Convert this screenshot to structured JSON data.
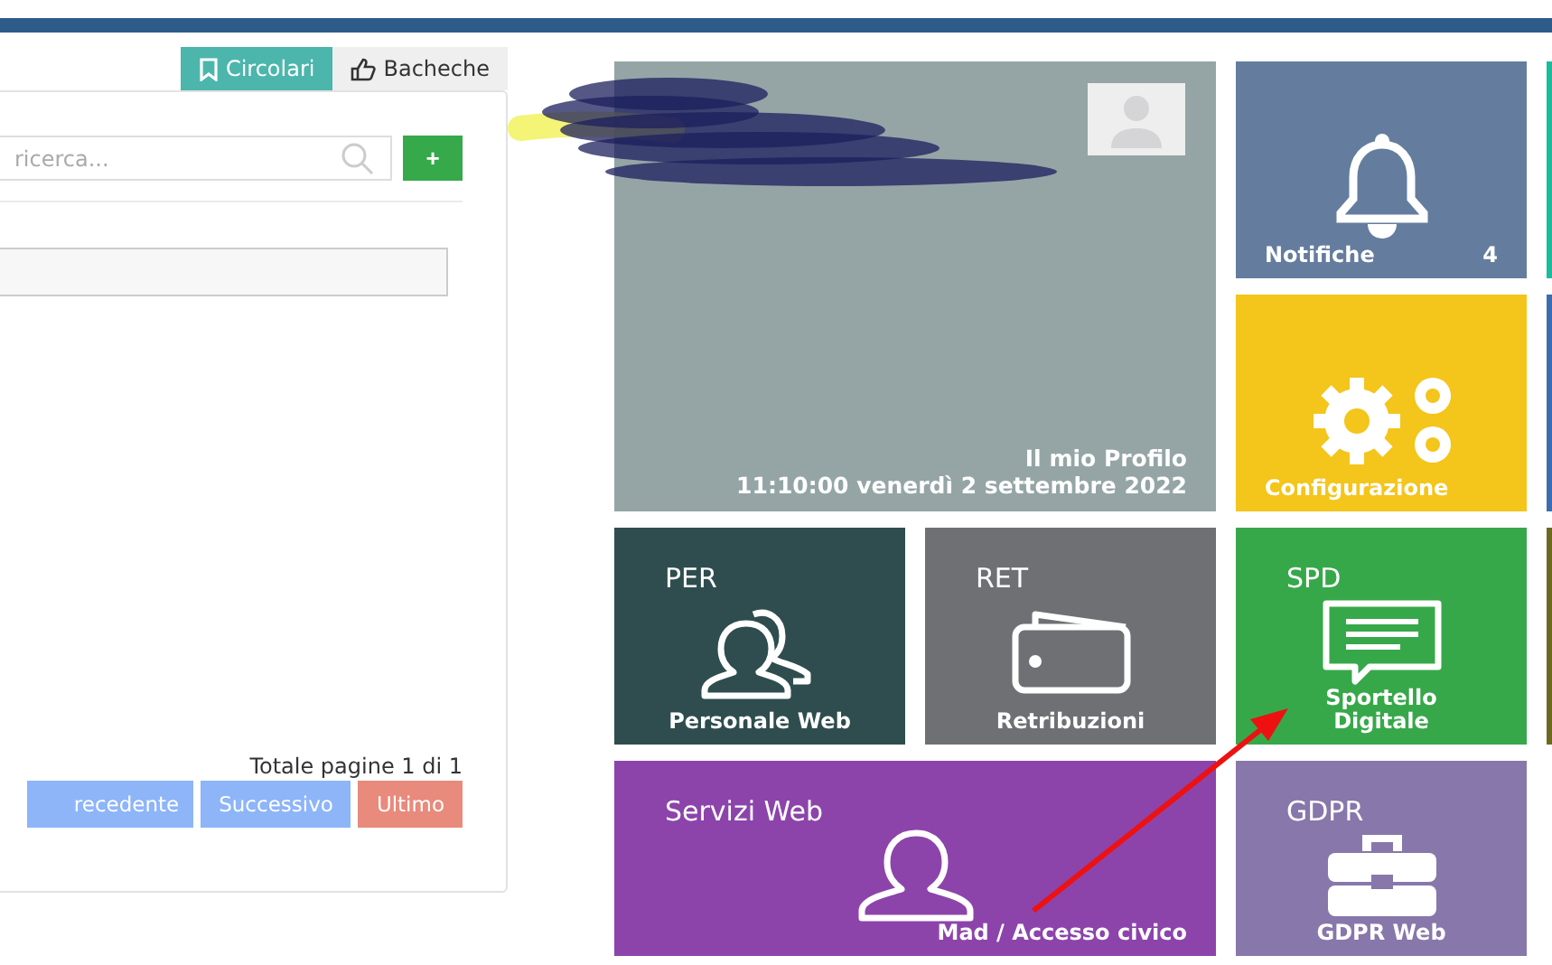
{
  "tabs": [
    {
      "label": "Circolari",
      "selected": true,
      "kind": "bookmark"
    },
    {
      "label": "Bacheche",
      "selected": false,
      "kind": "thumb"
    }
  ],
  "search": {
    "placeholder": "ricerca...",
    "add_button": "+"
  },
  "pagination": {
    "summary": "Totale pagine 1 di 1",
    "buttons": [
      {
        "label": "recedente",
        "kind": "nav"
      },
      {
        "label": "Successivo",
        "kind": "nav"
      },
      {
        "label": "Ultimo",
        "kind": "last"
      }
    ]
  },
  "tiles": [
    {
      "kind": "profile",
      "color": "#95a5a6",
      "caption": "Il mio Profilo",
      "datetime": "11:10:00 venerdì 2 settembre 2022"
    },
    {
      "kind": "bell",
      "color": "#647d9e",
      "label": "Notifiche",
      "count": "4"
    },
    {
      "kind": "blank",
      "color": "#1abc9c"
    },
    {
      "kind": "gears",
      "color": "#f4c51a",
      "label": "Configurazione"
    },
    {
      "kind": "blank",
      "color": "#3b6db3"
    },
    {
      "kind": "users",
      "color": "#2f4d4e",
      "code": "PER",
      "label": "Personale Web"
    },
    {
      "kind": "wallet",
      "color": "#6e7074",
      "code": "RET",
      "label": "Retribuzioni"
    },
    {
      "kind": "chat",
      "color": "#37a84a",
      "code": "SPD",
      "label": "Sportello Digitale"
    },
    {
      "kind": "blank",
      "color": "#6d6a1f"
    },
    {
      "kind": "wide",
      "color": "#8c44ab",
      "code": "Servizi Web",
      "label": "Mad / Accesso civico"
    },
    {
      "kind": "briefcase",
      "color": "#8877aa",
      "code": "GDPR",
      "label": "GDPR Web"
    }
  ]
}
